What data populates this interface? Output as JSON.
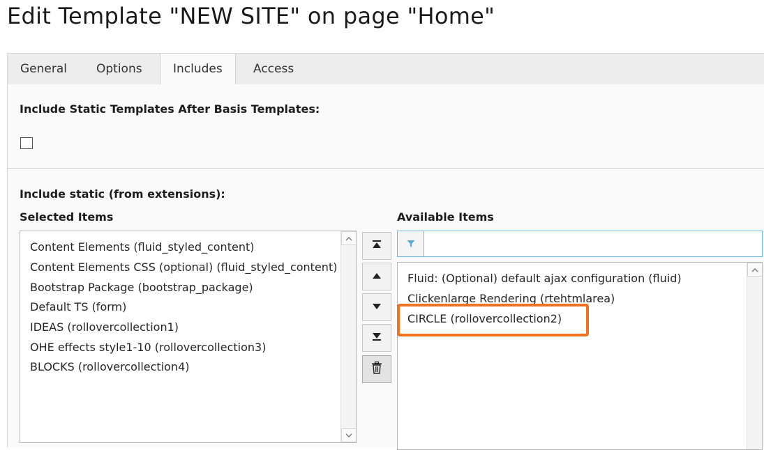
{
  "page": {
    "title": "Edit Template \"NEW SITE\" on page \"Home\""
  },
  "tabs": [
    {
      "label": "General",
      "active": false
    },
    {
      "label": "Options",
      "active": false
    },
    {
      "label": "Includes",
      "active": true
    },
    {
      "label": "Access",
      "active": false
    }
  ],
  "static_after_basis": {
    "label": "Include Static Templates After Basis Templates:",
    "checked": false
  },
  "include_static": {
    "label": "Include static (from extensions):",
    "selected_header": "Selected Items",
    "available_header": "Available Items",
    "selected_items": [
      "Content Elements (fluid_styled_content)",
      "Content Elements CSS (optional) (fluid_styled_content)",
      "Bootstrap Package (bootstrap_package)",
      "Default TS (form)",
      "IDEAS (rollovercollection1)",
      "OHE effects style1-10 (rollovercollection3)",
      "BLOCKS (rollovercollection4)"
    ],
    "available_items": [
      "Fluid: (Optional) default ajax configuration (fluid)",
      "Clickenlarge Rendering (rtehtmlarea)",
      "CIRCLE (rollovercollection2)"
    ],
    "highlighted_available_item": "CIRCLE (rollovercollection2)",
    "filter_placeholder": "",
    "filter_value": ""
  },
  "buttons": {
    "move_top_icon": "move-to-top-icon",
    "move_up_icon": "move-up-icon",
    "move_down_icon": "move-down-icon",
    "move_bottom_icon": "move-to-bottom-icon",
    "delete_icon": "trash-icon",
    "filter_icon": "filter-icon"
  },
  "colors": {
    "highlight": "#f07322",
    "filter_accent": "#6ab7e2",
    "panel_bg": "#fafafa",
    "tab_bar_bg": "#ededed"
  }
}
